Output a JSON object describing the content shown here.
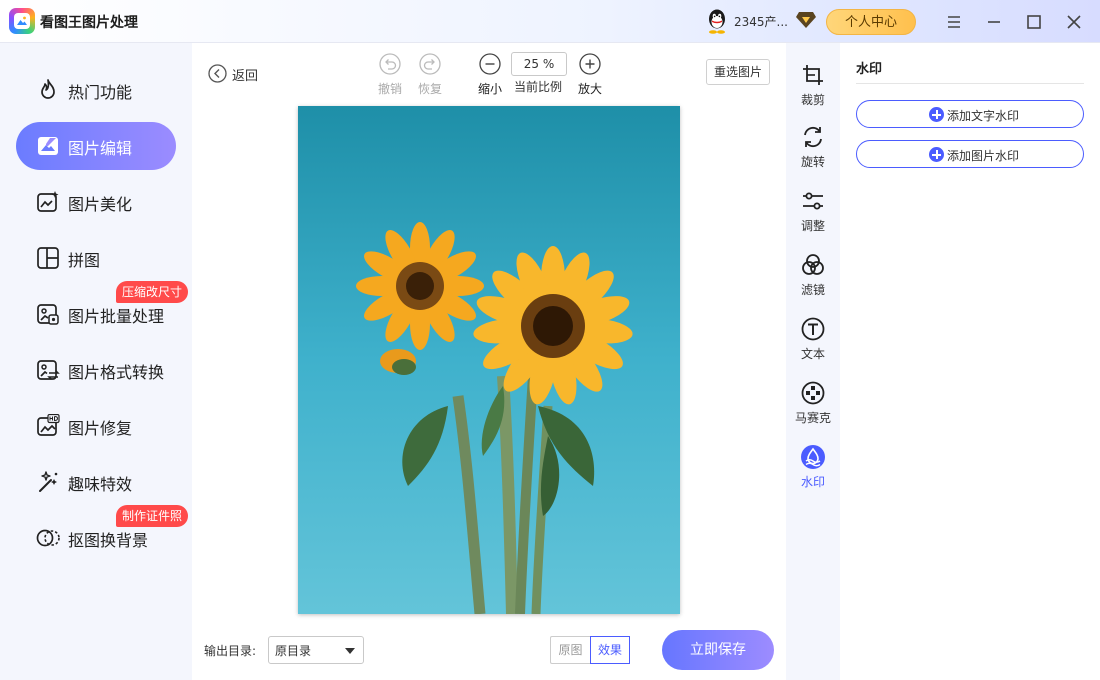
{
  "app": {
    "title": "看图王图片处理",
    "user_name": "2345产...",
    "personal_center": "个人中心"
  },
  "sidebar": {
    "items": [
      {
        "label": "热门功能",
        "icon": "flame-icon"
      },
      {
        "label": "图片编辑",
        "icon": "image-edit-icon",
        "active": true
      },
      {
        "label": "图片美化",
        "icon": "image-beautify-icon"
      },
      {
        "label": "拼图",
        "icon": "collage-icon"
      },
      {
        "label": "图片批量处理",
        "icon": "batch-image-icon",
        "badge": "压缩改尺寸"
      },
      {
        "label": "图片格式转换",
        "icon": "format-convert-icon"
      },
      {
        "label": "图片修复",
        "icon": "hd-repair-icon"
      },
      {
        "label": "趣味特效",
        "icon": "magic-wand-icon"
      },
      {
        "label": "抠图换背景",
        "icon": "cutout-icon",
        "badge": "制作证件照"
      }
    ]
  },
  "toolbar": {
    "back": "返回",
    "undo": "撤销",
    "redo": "恢复",
    "zoom_out": "缩小",
    "zoom_value": "25 %",
    "zoom_caption": "当前比例",
    "zoom_in": "放大",
    "reselect": "重选图片"
  },
  "bottom": {
    "output_label": "输出目录:",
    "output_value": "原目录",
    "view_original": "原图",
    "view_effect": "效果",
    "save": "立即保存"
  },
  "tools": [
    {
      "label": "裁剪",
      "icon": "crop-icon"
    },
    {
      "label": "旋转",
      "icon": "rotate-icon"
    },
    {
      "label": "调整",
      "icon": "adjust-icon"
    },
    {
      "label": "滤镜",
      "icon": "filter-icon"
    },
    {
      "label": "文本",
      "icon": "text-icon"
    },
    {
      "label": "马赛克",
      "icon": "mosaic-icon"
    },
    {
      "label": "水印",
      "icon": "watermark-icon",
      "active": true
    }
  ],
  "panel": {
    "title": "水印",
    "add_text_watermark": "添加文字水印",
    "add_image_watermark": "添加图片水印"
  },
  "colors": {
    "accent": "#4b5cff",
    "accent_gradient_end": "#9d8cff",
    "badge": "#ff4a4a",
    "vip_button": "#ffc04d"
  }
}
